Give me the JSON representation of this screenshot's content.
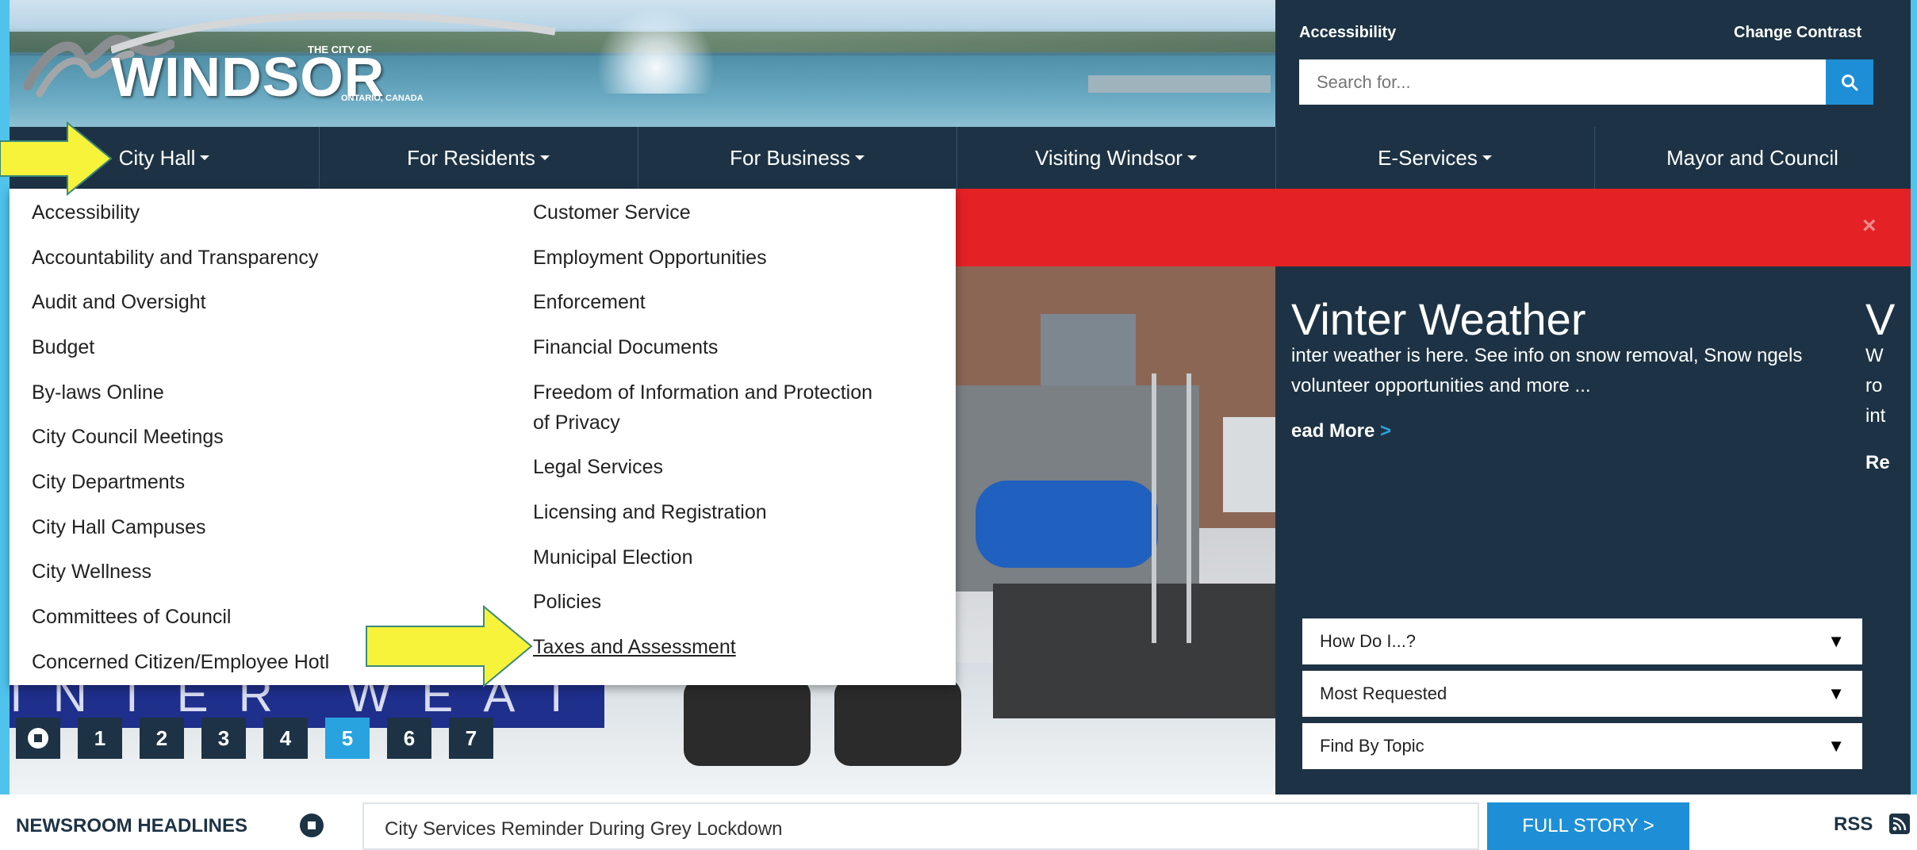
{
  "header": {
    "logo": {
      "the_city_of": "THE CITY OF",
      "windsor": "WINDSOR",
      "ontario": "ONTARIO, CANADA"
    },
    "accessibility_label": "Accessibility",
    "change_contrast_label": "Change Contrast",
    "search_placeholder": "Search for...",
    "search_icon": "search-icon"
  },
  "nav": {
    "items": [
      {
        "label": "City Hall",
        "dropdown": true
      },
      {
        "label": "For Residents",
        "dropdown": true
      },
      {
        "label": "For Business",
        "dropdown": true
      },
      {
        "label": "Visiting Windsor",
        "dropdown": true
      },
      {
        "label": "E-Services",
        "dropdown": true
      },
      {
        "label": "Mayor and Council",
        "dropdown": false
      }
    ]
  },
  "dropdown": {
    "col1": [
      "Accessibility",
      "Accountability and Transparency",
      "Audit and Oversight",
      "Budget",
      "By-laws Online",
      "City Council Meetings",
      "City Departments",
      "City Hall Campuses",
      "City Wellness",
      "Committees of Council",
      "Concerned Citizen/Employee Hotl"
    ],
    "col2": [
      "Customer Service",
      "Employment Opportunities",
      "Enforcement",
      "Financial Documents",
      "Freedom of Information and Protection",
      "of Privacy",
      "Legal Services",
      "Licensing and Registration",
      "Municipal Election",
      "Policies",
      "Taxes and Assessment"
    ]
  },
  "alert": {
    "close_icon": "close-icon",
    "close_glyph": "×"
  },
  "hero": {
    "banner_text": "INTER WEATHER",
    "slides": [
      "1",
      "2",
      "3",
      "4",
      "5",
      "6",
      "7"
    ],
    "active_slide": "5",
    "pause_icon": "pause-icon"
  },
  "feature": {
    "title": "Vinter Weather",
    "text": "inter weather is here. See info on snow removal, Snow ngels volunteer opportunities and more ...",
    "read_more": "ead More",
    "read_more_arrow": ">",
    "title2": "V",
    "text2": "W ro int",
    "read_more2": "Re"
  },
  "quick_selects": [
    {
      "label": "How Do I...?",
      "arrow": "▼"
    },
    {
      "label": "Most Requested",
      "arrow": "▼"
    },
    {
      "label": "Find By Topic",
      "arrow": "▼"
    }
  ],
  "newsroom": {
    "label": "NEWSROOM HEADLINES",
    "headline": "City Services Reminder During Grey Lockdown",
    "full_story": "FULL STORY >",
    "rss": "RSS",
    "rss_icon": "rss-icon"
  },
  "annotations": {
    "arrow_color": "#f6f33a",
    "arrow_outline": "#3a8a7a"
  },
  "colors": {
    "navy": "#1d3345",
    "accent_blue": "#1e8fd6",
    "alert_red": "#e42125",
    "active_slide": "#29a3e0"
  }
}
